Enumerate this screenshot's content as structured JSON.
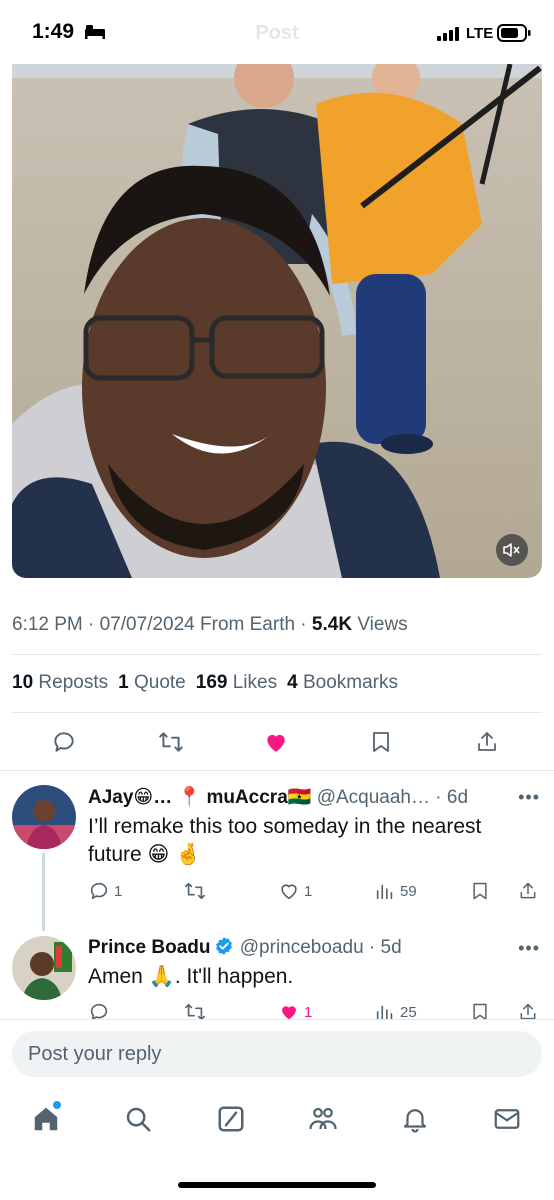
{
  "status_bar": {
    "time": "1:49",
    "network": "LTE"
  },
  "header": {
    "title": "Post"
  },
  "post": {
    "timestamp": "6:12 PM · 07/07/2024 From Earth · ",
    "views_count": "5.4K",
    "views_label": " Views",
    "stats": {
      "reposts_count": "10",
      "reposts_label": "Reposts",
      "quotes_count": "1",
      "quotes_label": "Quote",
      "likes_count": "169",
      "likes_label": "Likes",
      "bookmarks_count": "4",
      "bookmarks_label": "Bookmarks"
    },
    "liked": true
  },
  "replies": [
    {
      "name": "AJay😁… 📍 muAccra🇬🇭",
      "handle": "@Acquaah… · 6d",
      "more": "•••",
      "text": "I’ll remake this too someday in the nearest future 😁 🤞",
      "reply_count": "1",
      "repost_count": "",
      "like_count": "1",
      "view_count": "59"
    },
    {
      "name": "Prince Boadu",
      "handle": "@princeboadu · 5d",
      "more": "•••",
      "text": "Amen 🙏.  It'll happen.",
      "reply_count": "",
      "repost_count": "",
      "like_count": "1",
      "view_count": "25",
      "verified": true
    }
  ],
  "composer": {
    "placeholder": "Post your reply"
  },
  "colors": {
    "like_active": "#f91880",
    "verified": "#1d9bf0",
    "secondary_text": "#536471"
  },
  "icons": [
    "reply-icon",
    "repost-icon",
    "like-icon",
    "bookmark-icon",
    "share-icon",
    "views-icon",
    "home-icon",
    "search-icon",
    "compose-icon",
    "communities-icon",
    "notifications-icon",
    "messages-icon",
    "mute-icon"
  ]
}
